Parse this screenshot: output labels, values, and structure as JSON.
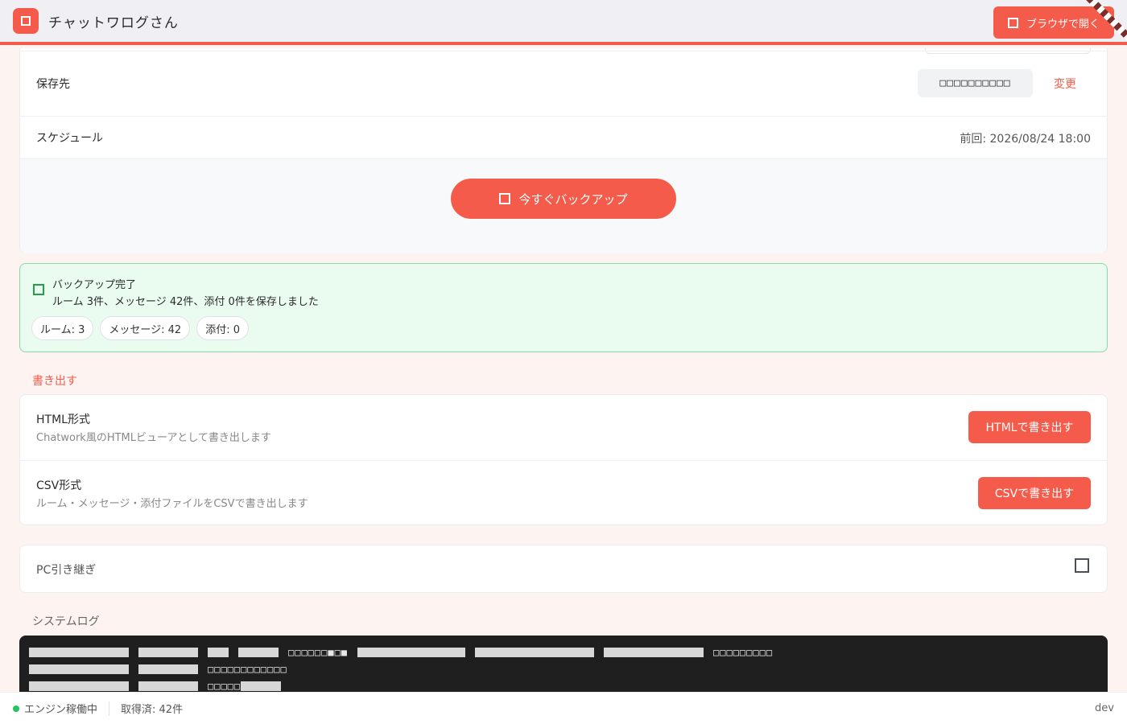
{
  "app": {
    "title": "チャットワログさん",
    "open_in_browser": "ブラウザで開く"
  },
  "backup": {
    "save_location_label": "保存先",
    "save_location_value": "□□□□□□□□□□",
    "change_label": "変更",
    "schedule_label": "スケジュール",
    "last_run": "前回: 2026/08/24 18:00",
    "backup_now": "今すぐバックアップ"
  },
  "result": {
    "title": "バックアップ完了",
    "description": "ルーム 3件、メッセージ 42件、添付 0件を保存しました",
    "chips": [
      "ルーム: 3",
      "メッセージ: 42",
      "添付: 0"
    ]
  },
  "export": {
    "section_title": "書き出す",
    "items": [
      {
        "name": "HTML形式",
        "description": "Chatwork風のHTMLビューアとして書き出します",
        "button": "HTMLで書き出す"
      },
      {
        "name": "CSV形式",
        "description": "ルーム・メッセージ・添付ファイルをCSVで書き出します",
        "button": "CSVで書き出す"
      }
    ]
  },
  "pc_transfer": {
    "label": "PC引き継ぎ"
  },
  "system_log": {
    "title": "システムログ",
    "lines": [
      "□□□□□□■□■",
      "□□□□□□□□□□□□",
      "□□□□□"
    ],
    "line1_extra": "□□□□□□□□□"
  },
  "status": {
    "engine": "エンジン稼働中",
    "fetched": "取得済: 42件",
    "env": "dev"
  },
  "colors": {
    "accent": "#f45b4b",
    "success": "#20a24a",
    "success_bg": "#eafbf0"
  }
}
